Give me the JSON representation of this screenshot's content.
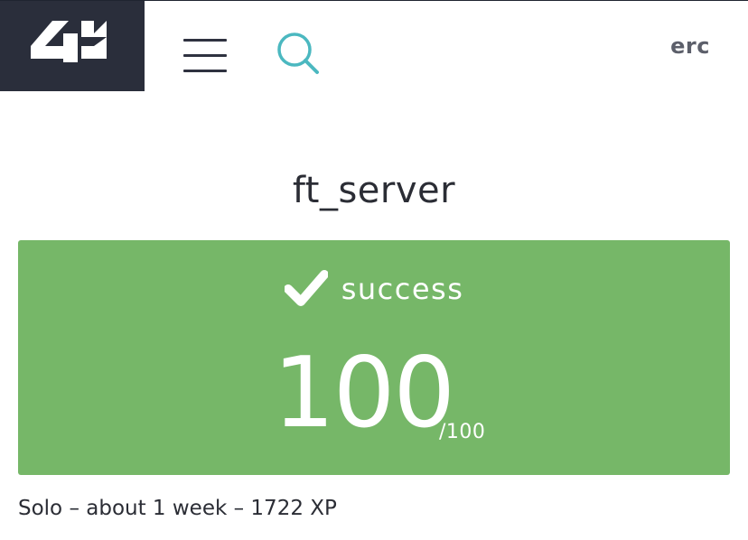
{
  "header": {
    "logo_text": "42",
    "menu_icon": "hamburger-menu-icon",
    "search_icon": "search-icon",
    "username": "erc"
  },
  "project": {
    "title": "ft_server",
    "status_icon": "check-icon",
    "status": "success",
    "score": "100",
    "score_max": "/100",
    "meta": "Solo – about 1 week – 1722 XP"
  },
  "colors": {
    "logo_bg": "#2a2e3b",
    "success_green": "#76b768",
    "search_accent": "#4bb8c0",
    "username": "#5c5f6a"
  }
}
